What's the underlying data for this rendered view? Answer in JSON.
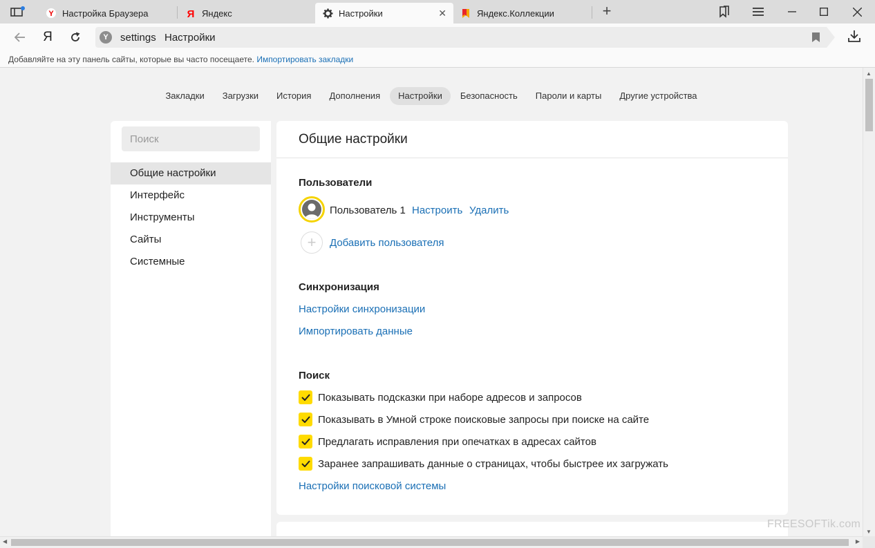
{
  "tabs": [
    {
      "label": "Настройка Браузера",
      "icon": "yandex-browser-icon",
      "active": false
    },
    {
      "label": "Яндекс",
      "icon": "yandex-ya-icon",
      "active": false
    },
    {
      "label": "Настройки",
      "icon": "gear-icon",
      "active": true
    },
    {
      "label": "Яндекс.Коллекции",
      "icon": "collections-bookmark-icon",
      "active": false
    }
  ],
  "nav": {
    "logo": "Я",
    "url_host": "settings",
    "url_title": "Настройки"
  },
  "bookmarks_bar": {
    "text": "Добавляйте на эту панель сайты, которые вы часто посещаете.",
    "link": "Импортировать закладки"
  },
  "topnav": [
    {
      "label": "Закладки",
      "active": false
    },
    {
      "label": "Загрузки",
      "active": false
    },
    {
      "label": "История",
      "active": false
    },
    {
      "label": "Дополнения",
      "active": false
    },
    {
      "label": "Настройки",
      "active": true
    },
    {
      "label": "Безопасность",
      "active": false
    },
    {
      "label": "Пароли и карты",
      "active": false
    },
    {
      "label": "Другие устройства",
      "active": false
    }
  ],
  "sidebar": {
    "search_placeholder": "Поиск",
    "items": [
      {
        "label": "Общие настройки",
        "active": true
      },
      {
        "label": "Интерфейс",
        "active": false
      },
      {
        "label": "Инструменты",
        "active": false
      },
      {
        "label": "Сайты",
        "active": false
      },
      {
        "label": "Системные",
        "active": false
      }
    ]
  },
  "content": {
    "title": "Общие настройки",
    "users": {
      "title": "Пользователи",
      "user_name": "Пользователь 1",
      "configure": "Настроить",
      "delete": "Удалить",
      "add_user": "Добавить пользователя"
    },
    "sync": {
      "title": "Синхронизация",
      "settings_link": "Настройки синхронизации",
      "import_link": "Импортировать данные"
    },
    "search": {
      "title": "Поиск",
      "options": [
        {
          "label": "Показывать подсказки при наборе адресов и запросов",
          "checked": true
        },
        {
          "label": "Показывать в Умной строке поисковые запросы при поиске на сайте",
          "checked": true
        },
        {
          "label": "Предлагать исправления при опечатках в адресах сайтов",
          "checked": true
        },
        {
          "label": "Заранее запрашивать данные о страницах, чтобы быстрее их загружать",
          "checked": true
        }
      ],
      "engine_link": "Настройки поисковой системы"
    }
  },
  "watermark": "FREESOFTik.com",
  "colors": {
    "accent_yellow": "#ffdb00",
    "link_blue": "#1a6fb5",
    "yandex_red": "#ff0000"
  }
}
